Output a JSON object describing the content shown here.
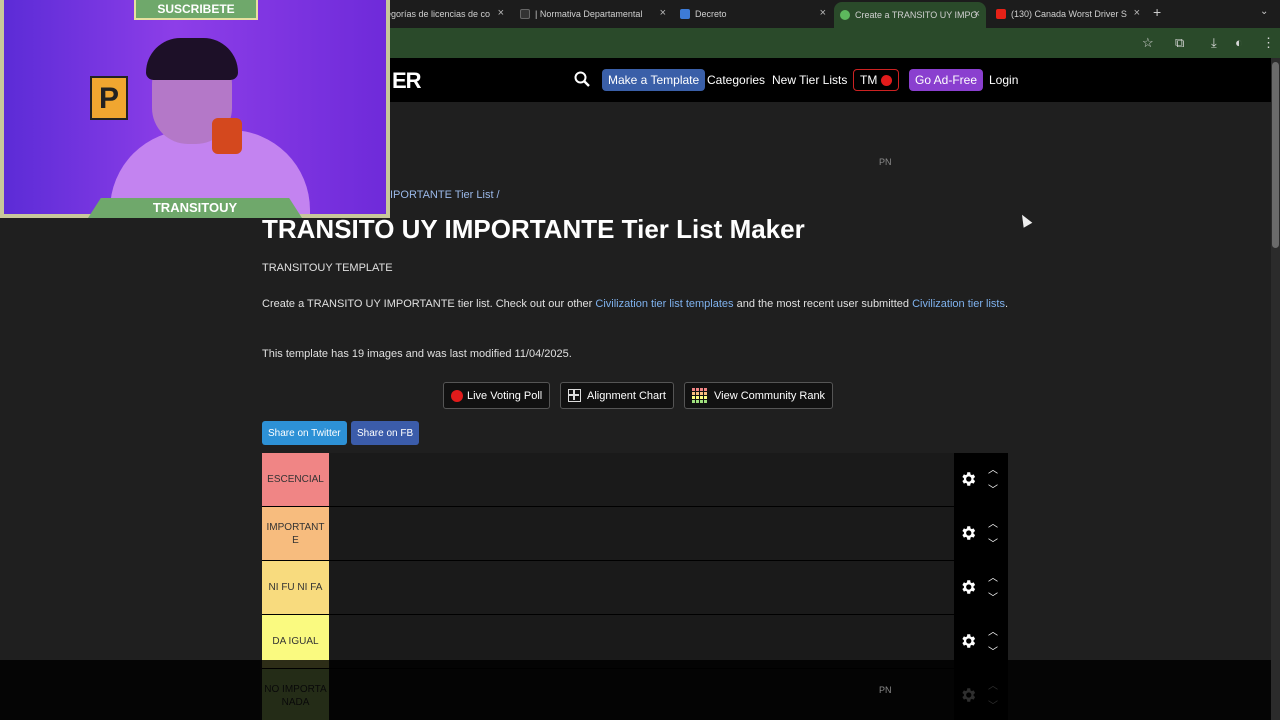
{
  "browser": {
    "tabs": [
      {
        "label": "egorías de licencias de co",
        "favicon_color": "#7ab04a"
      },
      {
        "label": "| Normativa Departamental",
        "favicon_color": "#333333"
      },
      {
        "label": "Decreto",
        "favicon_color": "#3d7bd6"
      },
      {
        "label": "Create a TRANSITO UY IMPO",
        "favicon_color": "#5db85d"
      },
      {
        "label": "(130) Canada Worst Driver S",
        "favicon_color": "#e62117"
      }
    ],
    "close_glyph": "×",
    "newtab_glyph": "+",
    "menu_glyph": "⌄"
  },
  "nav": {
    "logo": "ER",
    "make_template": "Make a Template",
    "categories": "Categories",
    "new_tier_lists": "New Tier Lists",
    "tm": "TM",
    "go_ad_free": "Go Ad-Free",
    "login": "Login"
  },
  "ad_marker": "PN",
  "breadcrumb": "IPORTANTE Tier List /",
  "title": "TRANSITO UY IMPORTANTE Tier List Maker",
  "subtitle": "TRANSITOUY TEMPLATE",
  "description": {
    "prefix": "Create a TRANSITO UY IMPORTANTE tier list. Check out our other ",
    "link1": "Civilization tier list templates",
    "middle": " and the most recent user submitted ",
    "link2": "Civilization tier lists",
    "suffix": "."
  },
  "meta": "This template has 19 images and was last modified 11/04/2025.",
  "tools": {
    "live_voting": "Live Voting Poll",
    "alignment_chart": "Alignment Chart",
    "community_rank": "View Community Rank"
  },
  "share": {
    "twitter": "Share on Twitter",
    "fb": "Share on FB"
  },
  "tiers": [
    {
      "label": "ESCENCIAL",
      "color": "#f08585"
    },
    {
      "label": "IMPORTANTE",
      "color": "#f7bc7e"
    },
    {
      "label": "NI FU NI FA",
      "color": "#f8db7e"
    },
    {
      "label": "DA IGUAL",
      "color": "#fafa80"
    },
    {
      "label": "NO IMPORTA NADA",
      "color": "#c5f07e"
    }
  ],
  "webcam": {
    "top_banner": "SUSCRIBETE",
    "name_banner": "TRANSITOUY",
    "sign_letter": "P"
  },
  "colors": {
    "accent_blue": "#3a5fa8",
    "accent_purple": "#8a3fcf",
    "link": "#7fb2ee",
    "twitter": "#2d91d6",
    "fb": "#3b5caa"
  }
}
